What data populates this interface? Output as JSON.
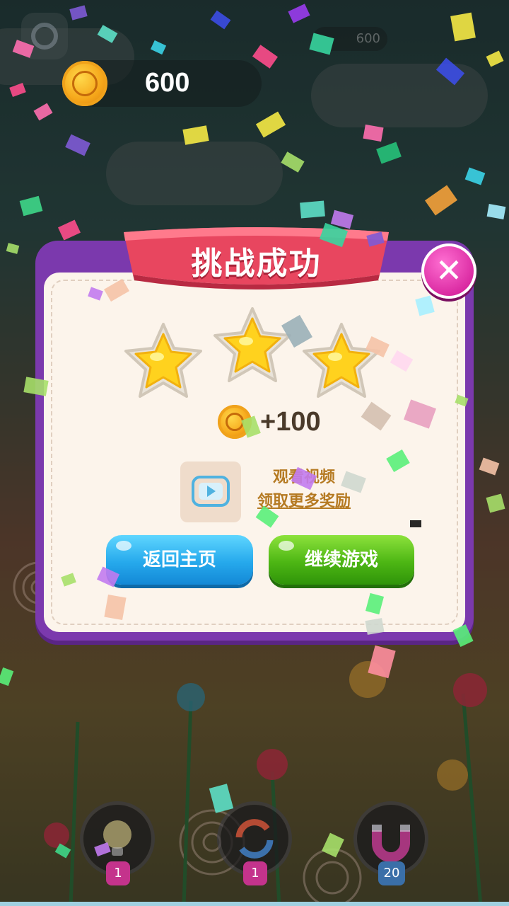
{
  "hud": {
    "coins": "600",
    "ghost_coins": "600"
  },
  "dialog": {
    "title": "挑战成功",
    "close_label": "✕",
    "stars_earned": 3,
    "stars_total": 3,
    "reward": "+100",
    "video_line1": "观看视频",
    "video_line2": "领取更多奖励",
    "home_button": "返回主页",
    "continue_button": "继续游戏"
  },
  "tools": [
    {
      "name": "hint",
      "icon": "lightbulb-icon",
      "count": "1"
    },
    {
      "name": "shuffle",
      "icon": "refresh-icon",
      "count": "1"
    },
    {
      "name": "magnet",
      "icon": "magnet-icon",
      "count": "20"
    }
  ],
  "colors": {
    "dialog_frame": "#7b39ad",
    "ribbon": "#e8465f",
    "home_button": "#26a9ec",
    "continue_button": "#4db614",
    "close_button": "#d8269f",
    "coin": "#f6a71a"
  }
}
